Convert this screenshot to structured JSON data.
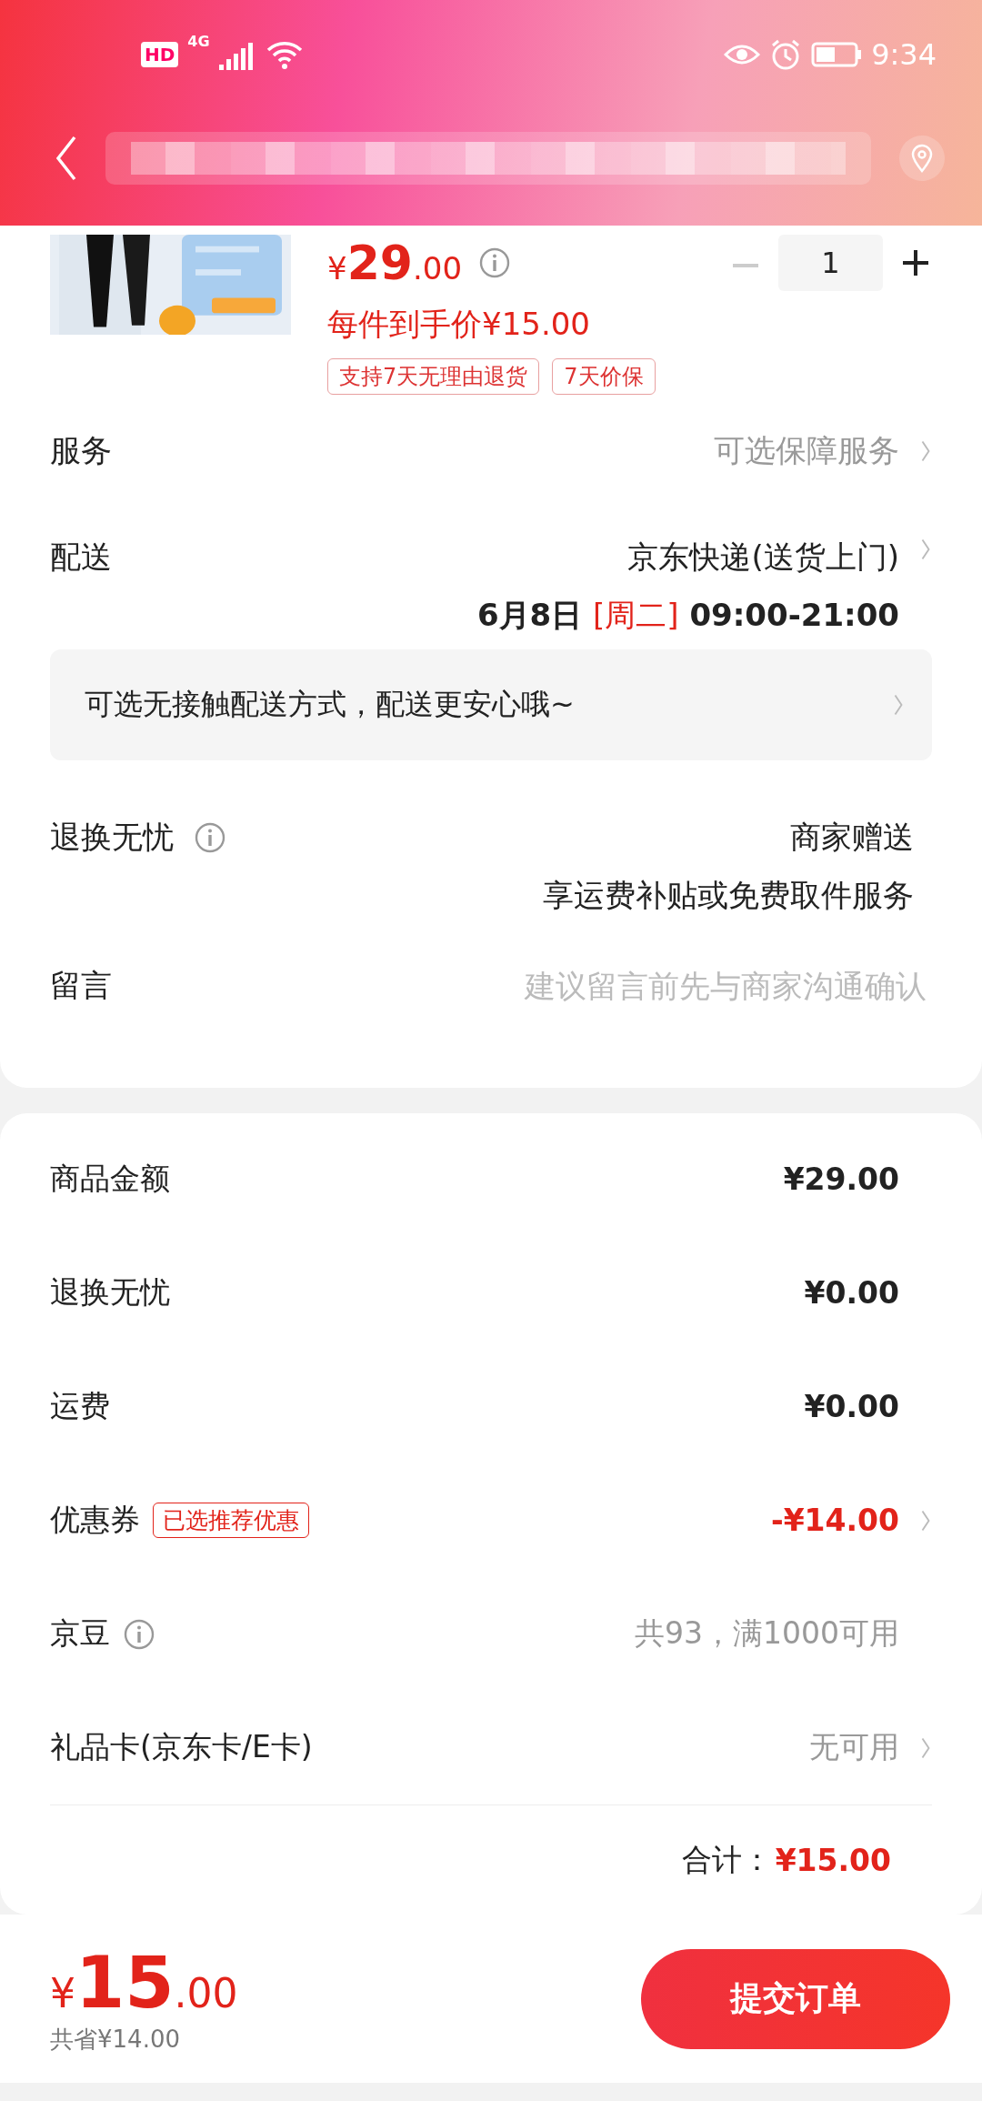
{
  "status_bar": {
    "hd": "HD",
    "network": "4G",
    "time": "9:34"
  },
  "product": {
    "price_symbol": "¥",
    "price_int": "29",
    "price_dec": ".00",
    "quantity": "1",
    "final_price": "每件到手价¥15.00",
    "tags": [
      "支持7天无理由退货",
      "7天价保"
    ]
  },
  "order_rows": [
    {
      "kind": "link",
      "label": "服务",
      "value": "可选保障服务",
      "muted": true
    },
    {
      "kind": "delivery",
      "label": "配送",
      "value": "京东快递(送货上门)",
      "date": "6月8日",
      "weekday": "[周二]",
      "time": "09:00-21:00"
    },
    {
      "kind": "notice",
      "text": "可选无接触配送方式，配送更安心哦~"
    },
    {
      "kind": "info",
      "label": "退换无忧",
      "value": "商家赠送",
      "detail": "享运费补贴或免费取件服务"
    },
    {
      "kind": "input",
      "label": "留言",
      "placeholder": "建议留言前先与商家沟通确认"
    }
  ],
  "summary_rows": [
    {
      "label": "商品金额",
      "value": "¥29.00",
      "arrow": false,
      "highlight": false
    },
    {
      "label": "退换无忧",
      "value": "¥0.00",
      "arrow": false,
      "highlight": false
    },
    {
      "label": "运费",
      "value": "¥0.00",
      "arrow": false,
      "highlight": false
    },
    {
      "label": "优惠券",
      "badge": "已选推荐优惠",
      "value": "-¥14.00",
      "arrow": true,
      "highlight": true
    },
    {
      "label": "京豆",
      "info": true,
      "value": "共93，满1000可用",
      "arrow": false,
      "highlight": false,
      "muted": true
    },
    {
      "label": "礼品卡(京东卡/E卡)",
      "value": "无可用",
      "arrow": true,
      "highlight": false,
      "muted": true
    }
  ],
  "total": {
    "label": "合计：",
    "value": "¥15.00"
  },
  "footer": {
    "price_symbol": "¥",
    "price_int": "15",
    "price_dec": ".00",
    "saved": "共省¥14.00",
    "submit": "提交订单"
  }
}
